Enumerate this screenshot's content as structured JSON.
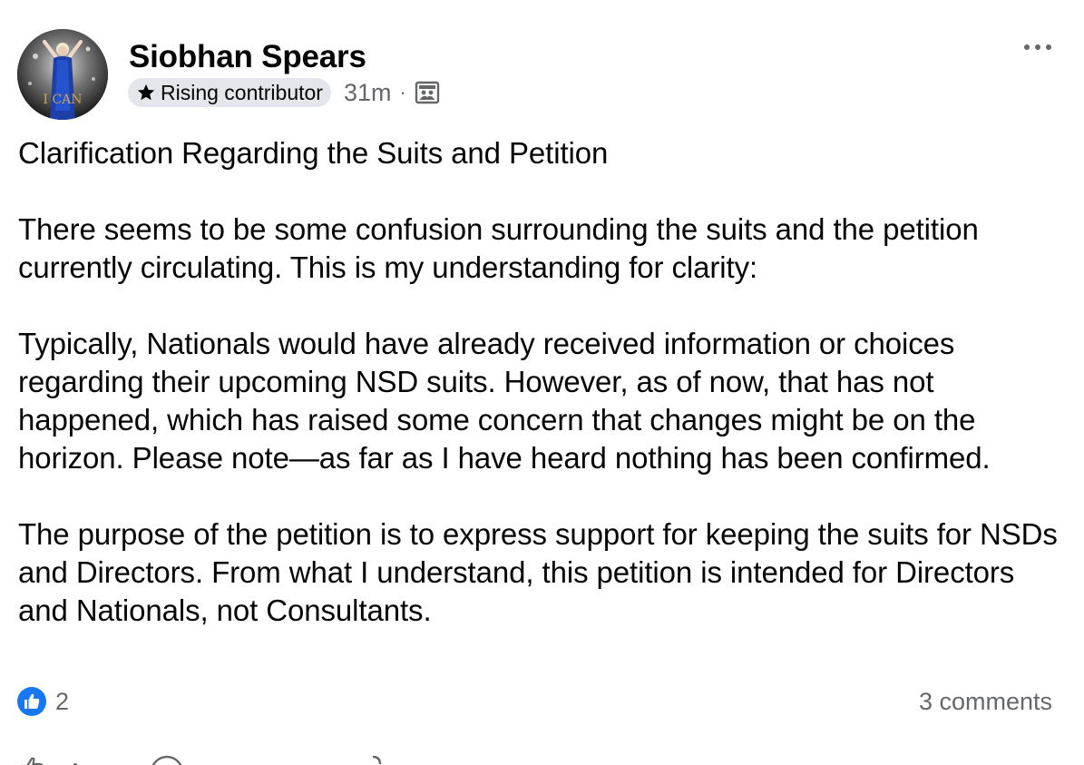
{
  "post": {
    "author": {
      "name": "Siobhan Spears",
      "badge": "Rising contributor",
      "badge_icon": "star-icon",
      "avatar_text": "I CAN"
    },
    "timestamp": "31m",
    "separator": "·",
    "audience_icon": "group-icon",
    "paragraphs": [
      "Clarification Regarding the Suits and Petition",
      "There seems to be some confusion surrounding the suits and the petition currently circulating. This is my understanding for clarity:",
      "Typically, Nationals would have already received information or choices regarding their upcoming NSD suits. However, as of now, that has not happened, which has raised some concern that changes might be on the horizon. Please note—as far as I have heard nothing has been confirmed.",
      "The purpose of the petition is to express support for keeping the suits for NSDs and Directors. From what I understand, this petition is intended for Directors and Nationals, not Consultants."
    ],
    "reactions": {
      "icon": "like-icon",
      "count": "2"
    },
    "comments": "3 comments"
  },
  "colors": {
    "like_blue": "#1877f2",
    "secondary_text": "#65676b",
    "badge_bg": "#e4e6eb"
  }
}
